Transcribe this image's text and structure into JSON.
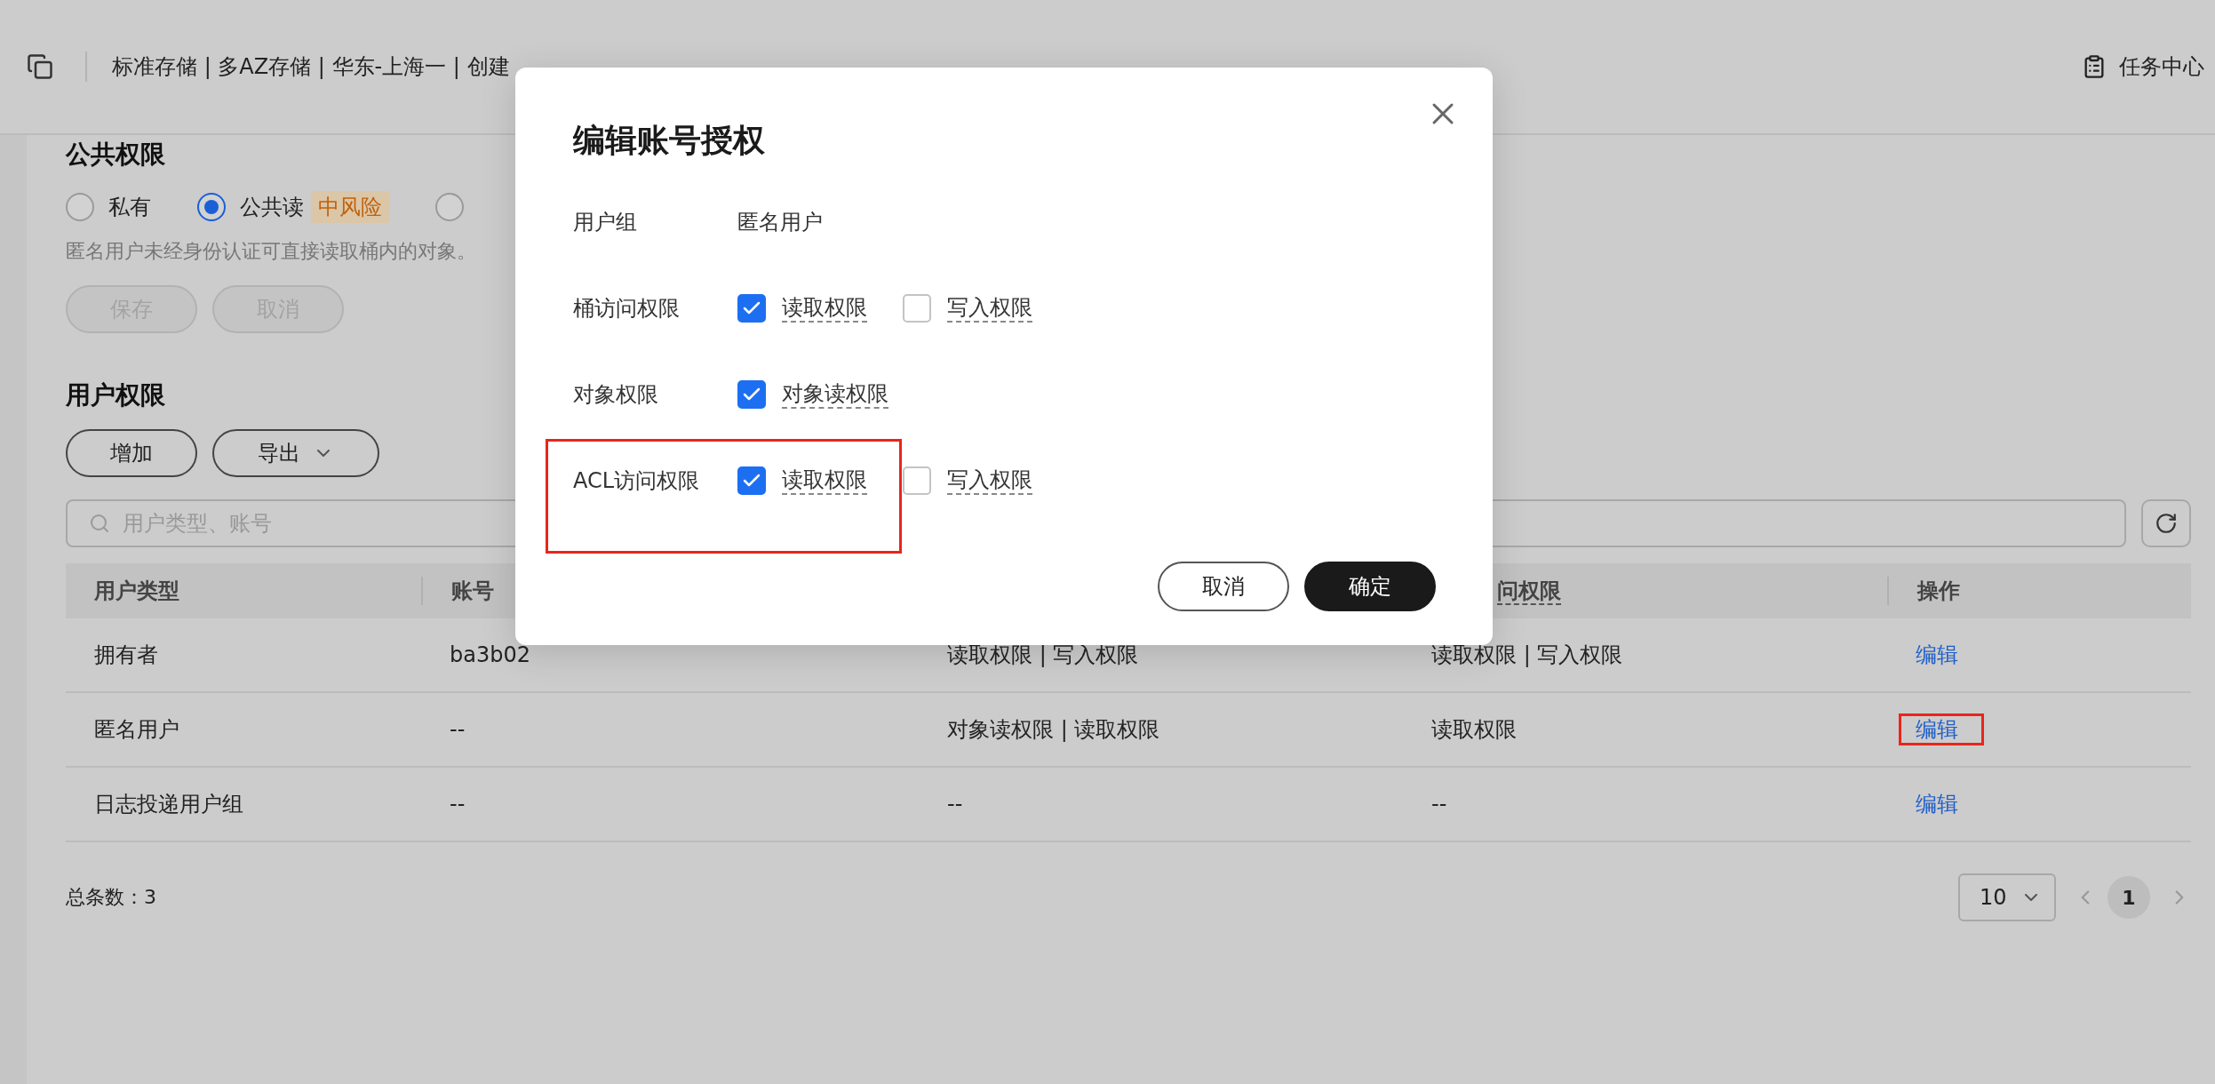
{
  "header": {
    "breadcrumb": "标准存储 | 多AZ存储 | 华东-上海一 | 创建",
    "task_center": "任务中心"
  },
  "public_access": {
    "title": "公共权限",
    "options": [
      {
        "label": "私有",
        "selected": false
      },
      {
        "label": "公共读",
        "selected": true,
        "tag": "中风险"
      },
      {
        "selected": false
      }
    ],
    "description": "匿名用户未经身份认证可直接读取桶内的对象。",
    "buttons": [
      {
        "label": "保存",
        "disabled": true
      },
      {
        "label": "取消",
        "disabled": true
      }
    ]
  },
  "user_permissions": {
    "title": "用户权限",
    "add_button": "增加",
    "export_button": "导出",
    "search": {
      "placeholder": "用户类型、账号"
    },
    "table": {
      "columns": [
        {
          "label": "用户类型"
        },
        {
          "label": "账号"
        },
        {},
        {
          "label": "问权限",
          "underlined": true
        },
        {
          "label": "操作"
        }
      ],
      "rows": [
        {
          "cells": [
            "拥有者",
            "ba3b02",
            "读取权限 | 写入权限",
            "读取权限 | 写入权限"
          ],
          "action": "编辑",
          "highlighted": false
        },
        {
          "cells": [
            "匿名用户",
            "--",
            "对象读权限 | 读取权限",
            "读取权限"
          ],
          "action": "编辑",
          "highlighted": true
        },
        {
          "cells": [
            "日志投递用户组",
            "--",
            "--",
            "--"
          ],
          "action": "编辑",
          "highlighted": false
        }
      ]
    },
    "footer": {
      "total": "总条数：3",
      "page_size": "10",
      "pages": [
        {
          "label": "1",
          "selected": true
        }
      ]
    }
  },
  "dialog": {
    "title": "编辑账号授权",
    "fields": [
      {
        "kind": "text",
        "label": "用户组",
        "value": "匿名用户",
        "highlighted": false
      },
      {
        "kind": "checks",
        "label": "桶访问权限",
        "highlighted": false,
        "options": [
          {
            "label": "读取权限",
            "checked": true
          },
          {
            "label": "写入权限",
            "checked": false
          }
        ]
      },
      {
        "kind": "checks",
        "label": "对象权限",
        "highlighted": false,
        "options": [
          {
            "label": "对象读权限",
            "checked": true
          }
        ]
      },
      {
        "kind": "checks",
        "label": "ACL访问权限",
        "highlighted": true,
        "options": [
          {
            "label": "读取权限",
            "checked": true
          },
          {
            "label": "写入权限",
            "checked": false
          }
        ]
      }
    ],
    "cancel": "取消",
    "confirm": "确定"
  }
}
